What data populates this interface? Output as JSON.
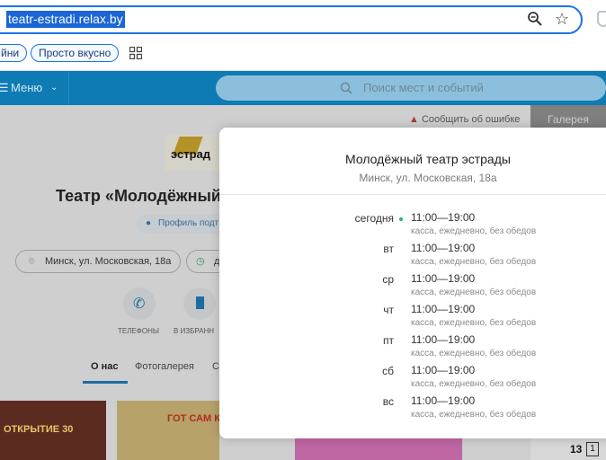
{
  "browser": {
    "url": "teatr-estradi.relax.by",
    "bookmarks": [
      "йни",
      "Просто вкусно"
    ]
  },
  "site": {
    "menu_label": "Меню",
    "search_placeholder": "Поиск мест и событий",
    "report_error": "Сообщить об ошибке",
    "gallery_tab": "Галерея",
    "venue_title": "Театр «Молодёжный",
    "profile_badge": "Профиль подт",
    "address": "Минск, ул. Московская, 18а",
    "second_chip": "д",
    "actions": [
      "ТЕЛЕФОНЫ",
      "В ИЗБРАНН"
    ],
    "tabs": [
      "О нас",
      "Фотогалерея",
      "С"
    ],
    "poster_text_1": "ОТКРЫТИЕ 30",
    "poster_text_2": "ГОТ САМ КАРАСО",
    "counter": "13",
    "counter_box": "1"
  },
  "modal": {
    "title": "Молодёжный театр эстрады",
    "address": "Минск, ул. Московская, 18а",
    "schedule": [
      {
        "day": "сегодня",
        "hours": "11:00—19:00",
        "note": "касса, ежедневно, без обедов"
      },
      {
        "day": "вт",
        "hours": "11:00—19:00",
        "note": "касса, ежедневно, без обедов"
      },
      {
        "day": "ср",
        "hours": "11:00—19:00",
        "note": "касса, ежедневно, без обедов"
      },
      {
        "day": "чт",
        "hours": "11:00—19:00",
        "note": "касса, ежедневно, без обедов"
      },
      {
        "day": "пт",
        "hours": "11:00—19:00",
        "note": "касса, ежедневно, без обедов"
      },
      {
        "day": "сб",
        "hours": "11:00—19:00",
        "note": "касса, ежедневно, без обедов"
      },
      {
        "day": "вс",
        "hours": "11:00—19:00",
        "note": "касса, ежедневно, без обедов"
      }
    ]
  },
  "colors": {
    "accent": "#1a73e8",
    "header": "#0e7bb5",
    "open_dot": "#2db06f"
  }
}
